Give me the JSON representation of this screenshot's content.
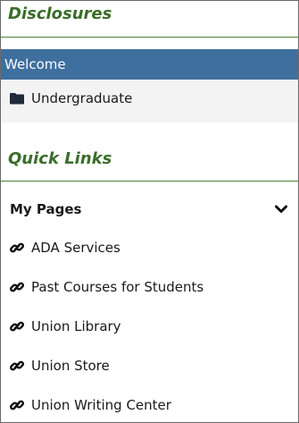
{
  "disclosures": {
    "heading": "Disclosures",
    "items": [
      {
        "label": "Welcome",
        "selected": true
      },
      {
        "label": "Undergraduate",
        "icon": "folder-icon"
      }
    ]
  },
  "quick_links": {
    "heading": "Quick Links",
    "group_label": "My Pages",
    "group_icon": "chevron-down-icon",
    "links": [
      {
        "label": "ADA Services",
        "icon": "link-icon"
      },
      {
        "label": "Past Courses for Students",
        "icon": "link-icon"
      },
      {
        "label": "Union Library",
        "icon": "link-icon"
      },
      {
        "label": "Union Store",
        "icon": "link-icon"
      },
      {
        "label": "Union Writing Center",
        "icon": "link-icon"
      }
    ]
  },
  "colors": {
    "heading_green": "#3b6d2a",
    "selected_blue": "#3f6f9e"
  }
}
